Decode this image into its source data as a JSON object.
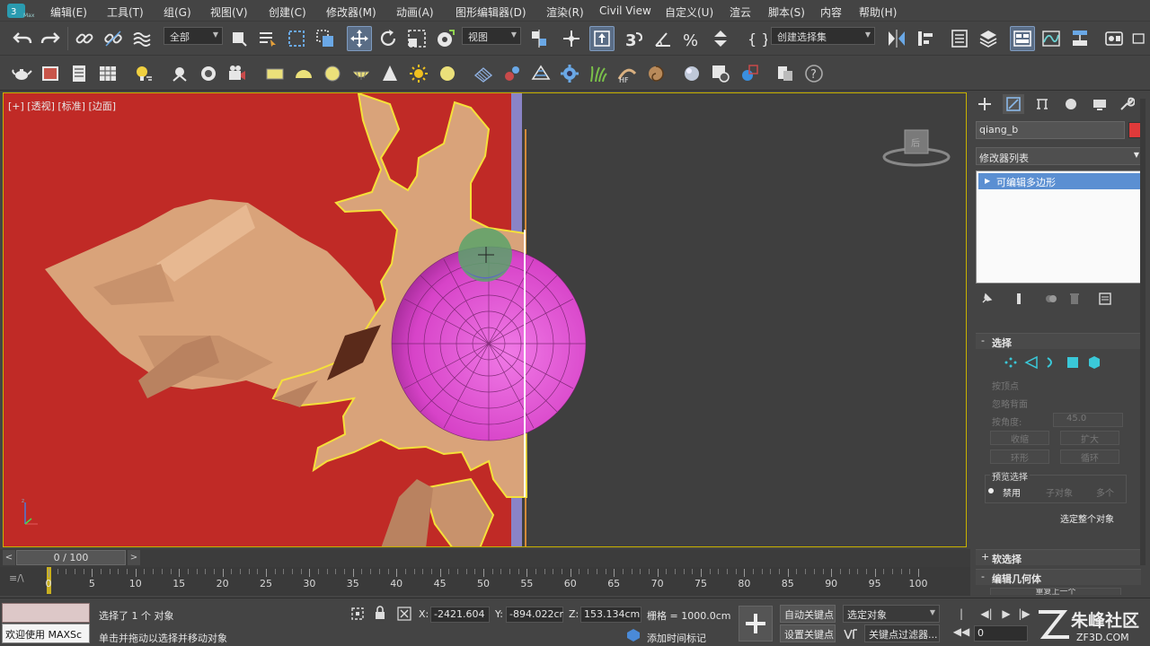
{
  "menu": {
    "items": [
      "编辑(E)",
      "工具(T)",
      "组(G)",
      "视图(V)",
      "创建(C)",
      "修改器(M)",
      "动画(A)",
      "图形编辑器(D)",
      "渲染(R)",
      "Civil View",
      "自定义(U)",
      "渲云",
      "脚本(S)",
      "内容",
      "帮助(H)"
    ]
  },
  "toolbar": {
    "selection_filter": "全部",
    "ref_coord": "视图",
    "named_selection": "创建选择集"
  },
  "viewport": {
    "label": "[+] [透视] [标准] [边面]",
    "viewcube_label": "后",
    "colors": {
      "background": "#3f3f3f",
      "wall": "#c02a26",
      "rock": "#d9a37a",
      "sphere": "#d743c8",
      "selection": "#f5e03a"
    }
  },
  "command_panel": {
    "object_name": "qiang_b",
    "object_color": "#e03a3a",
    "modifier_list_label": "修改器列表",
    "stack_item": "可编辑多边形",
    "selection_rollout": {
      "title": "选择",
      "by_vertex": "按顶点",
      "ignore_backfacing": "忽略背面",
      "by_angle_label": "按角度:",
      "by_angle_value": "45.0",
      "shrink": "收缩",
      "grow": "扩大",
      "ring": "环形",
      "loop": "循环",
      "preview_title": "预览选择",
      "preview_off": "禁用",
      "preview_sub": "子对象",
      "preview_multi": "多个",
      "select_whole": "选定整个对象"
    },
    "soft_selection": "软选择",
    "edit_geometry": "编辑几何体",
    "repeat_last": "重复上一个"
  },
  "time_slider": {
    "value": "0 / 100",
    "current": 0,
    "total": 100,
    "ticks": [
      "0",
      "5",
      "10",
      "15",
      "20",
      "25",
      "30",
      "35",
      "40",
      "45",
      "50",
      "55",
      "60",
      "65",
      "70",
      "75",
      "80",
      "85",
      "90",
      "95",
      "100"
    ]
  },
  "status": {
    "welcome": "欢迎使用 MAXSc",
    "selection_info": "选择了 1 个 对象",
    "prompt": "单击并拖动以选择并移动对象",
    "x_label": "X:",
    "x_value": "-2421.604",
    "y_label": "Y:",
    "y_value": "-894.022cr",
    "z_label": "Z:",
    "z_value": "153.134cm",
    "grid": "栅格 = 1000.0cm",
    "add_time_tag": "添加时间标记",
    "auto_key": "自动关键点",
    "set_key": "设置关键点",
    "key_mode": "选定对象",
    "key_filters": "关键点过滤器...",
    "frame_field": "0"
  },
  "watermark": {
    "name": "朱峰社区",
    "url": "ZF3D.COM"
  }
}
